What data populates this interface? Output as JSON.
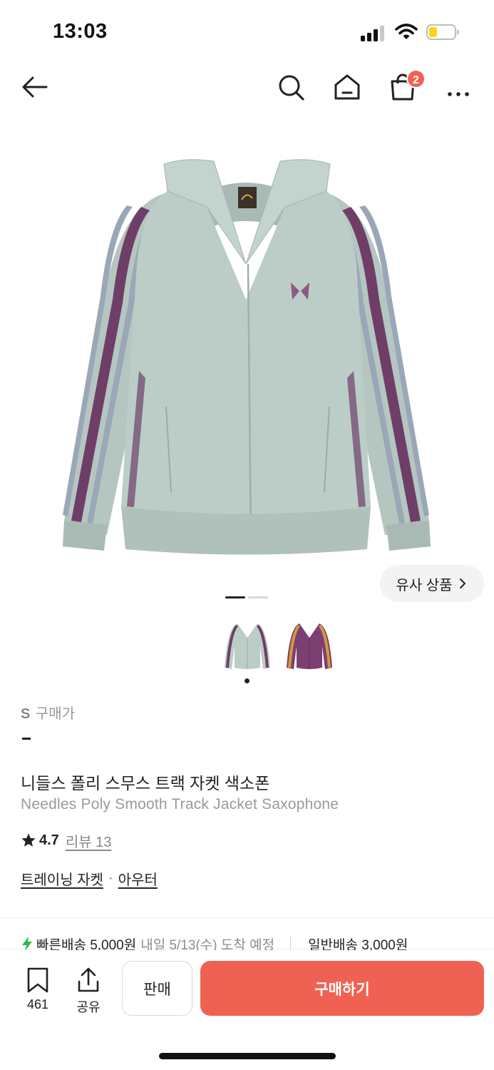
{
  "status_bar": {
    "time": "13:03",
    "icons": [
      "cellular-signal-icon",
      "wifi-icon",
      "battery-low-icon"
    ]
  },
  "header": {
    "icons": [
      "back-arrow-icon",
      "search-icon",
      "home-icon",
      "shopping-bag-icon",
      "more-dots-icon"
    ],
    "cart_badge": "2"
  },
  "gallery": {
    "main_image": "sage-green-track-jacket-purple-stripes",
    "similar_button": "유사 상품",
    "slides_total": 2,
    "slide_current": 1,
    "color_thumbnails": [
      "sage-green-track-jacket",
      "purple-track-jacket-orange-stripes"
    ],
    "selected_thumbnail": 0
  },
  "product": {
    "size": "S",
    "price_label": "구매가",
    "price": "-",
    "name_ko": "니들스 폴리 스무스 트랙 자켓 색소폰",
    "name_en": "Needles Poly Smooth Track Jacket Saxophone",
    "rating": "4.7",
    "review_label": "리뷰 13",
    "categories": [
      "트레이닝 자켓",
      "아우터"
    ],
    "category_separator": "·"
  },
  "shipping": {
    "fast_label": "빠른배송 5,000원",
    "fast_desc": "내일 5/13(수) 도착 예정",
    "normal_label": "일반배송 3,000원"
  },
  "bottom_bar": {
    "bookmark_count": "461",
    "share_label": "공유",
    "sell_label": "판매",
    "buy_label": "구매하기"
  },
  "colors": {
    "accent": "#ef6253",
    "text": "#222222",
    "muted": "#999999",
    "jacket": "#b9cac5",
    "stripe": "#6e3e68"
  }
}
